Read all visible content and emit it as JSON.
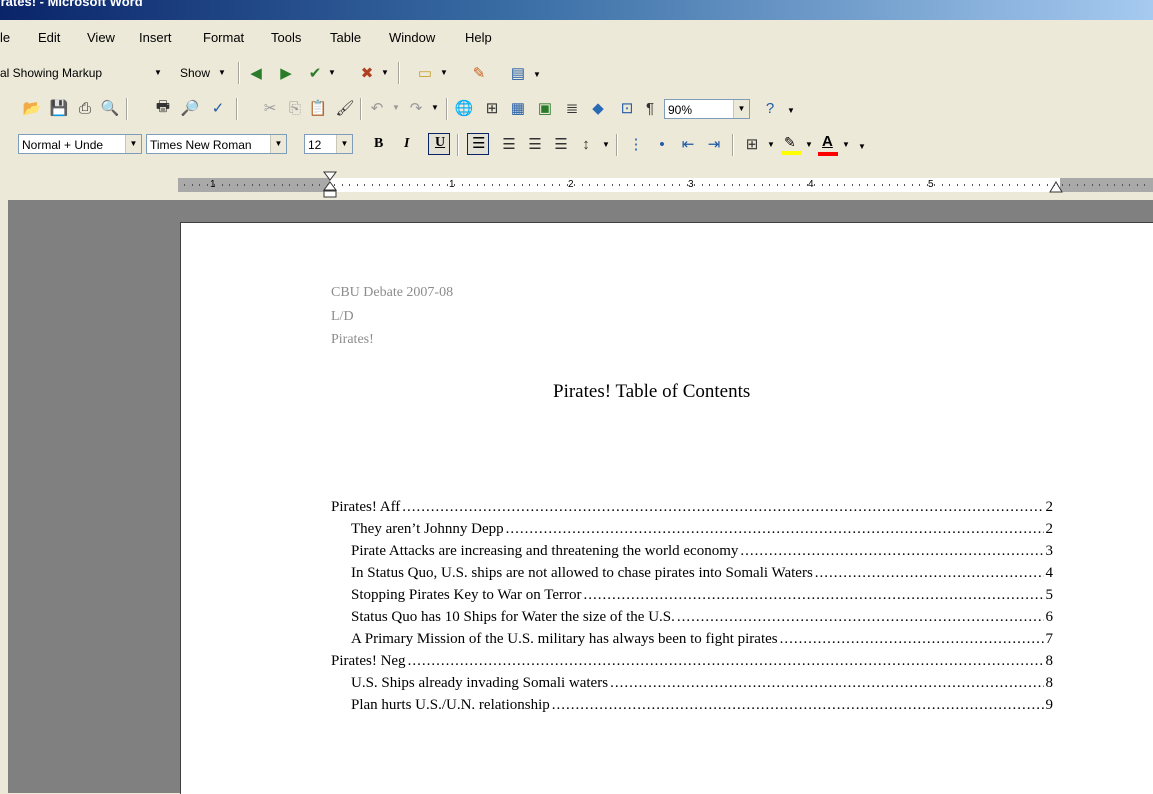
{
  "window": {
    "title": "irates! - Microsoft Word"
  },
  "menu": [
    "le",
    "Edit",
    "View",
    "Insert",
    "Format",
    "Tools",
    "Table",
    "Window",
    "Help"
  ],
  "toolbar1": {
    "markup_display": "al Showing Markup",
    "show_label": "Show"
  },
  "toolbar2": {
    "zoom": "90%"
  },
  "toolbar3": {
    "style": "Normal + Unde",
    "font": "Times New Roman",
    "size": "12",
    "bold": "B",
    "italic": "I",
    "underline": "U"
  },
  "ruler": {
    "numbers": [
      "1",
      "1",
      "2",
      "3",
      "4",
      "5"
    ]
  },
  "document": {
    "header_lines": [
      "CBU Debate 2007-08",
      "L/D",
      "Pirates!"
    ],
    "title": "Pirates! Table of Contents",
    "toc": [
      {
        "level": 1,
        "text": "Pirates! Aff",
        "page": "2"
      },
      {
        "level": 2,
        "text": "They aren’t Johnny Depp",
        "page": "2"
      },
      {
        "level": 2,
        "text": "Pirate Attacks are increasing and threatening the world economy",
        "page": "3"
      },
      {
        "level": 2,
        "text": "In Status Quo, U.S. ships are not allowed to chase pirates into Somali Waters",
        "page": "4"
      },
      {
        "level": 2,
        "text": "Stopping Pirates Key to War on Terror",
        "page": "5"
      },
      {
        "level": 2,
        "text": "Status Quo has 10 Ships for Water the size of the U.S.",
        "page": "6"
      },
      {
        "level": 2,
        "text": "A Primary Mission of the U.S. military has always been to fight pirates",
        "page": "7"
      },
      {
        "level": 1,
        "text": "Pirates! Neg",
        "page": "8"
      },
      {
        "level": 2,
        "text": "U.S. Ships already invading Somali waters",
        "page": "8"
      },
      {
        "level": 2,
        "text": "Plan hurts U.S./U.N. relationship",
        "page": "9"
      }
    ]
  },
  "colors": {
    "highlight": "#ffff00",
    "font_color": "#ff0000"
  }
}
